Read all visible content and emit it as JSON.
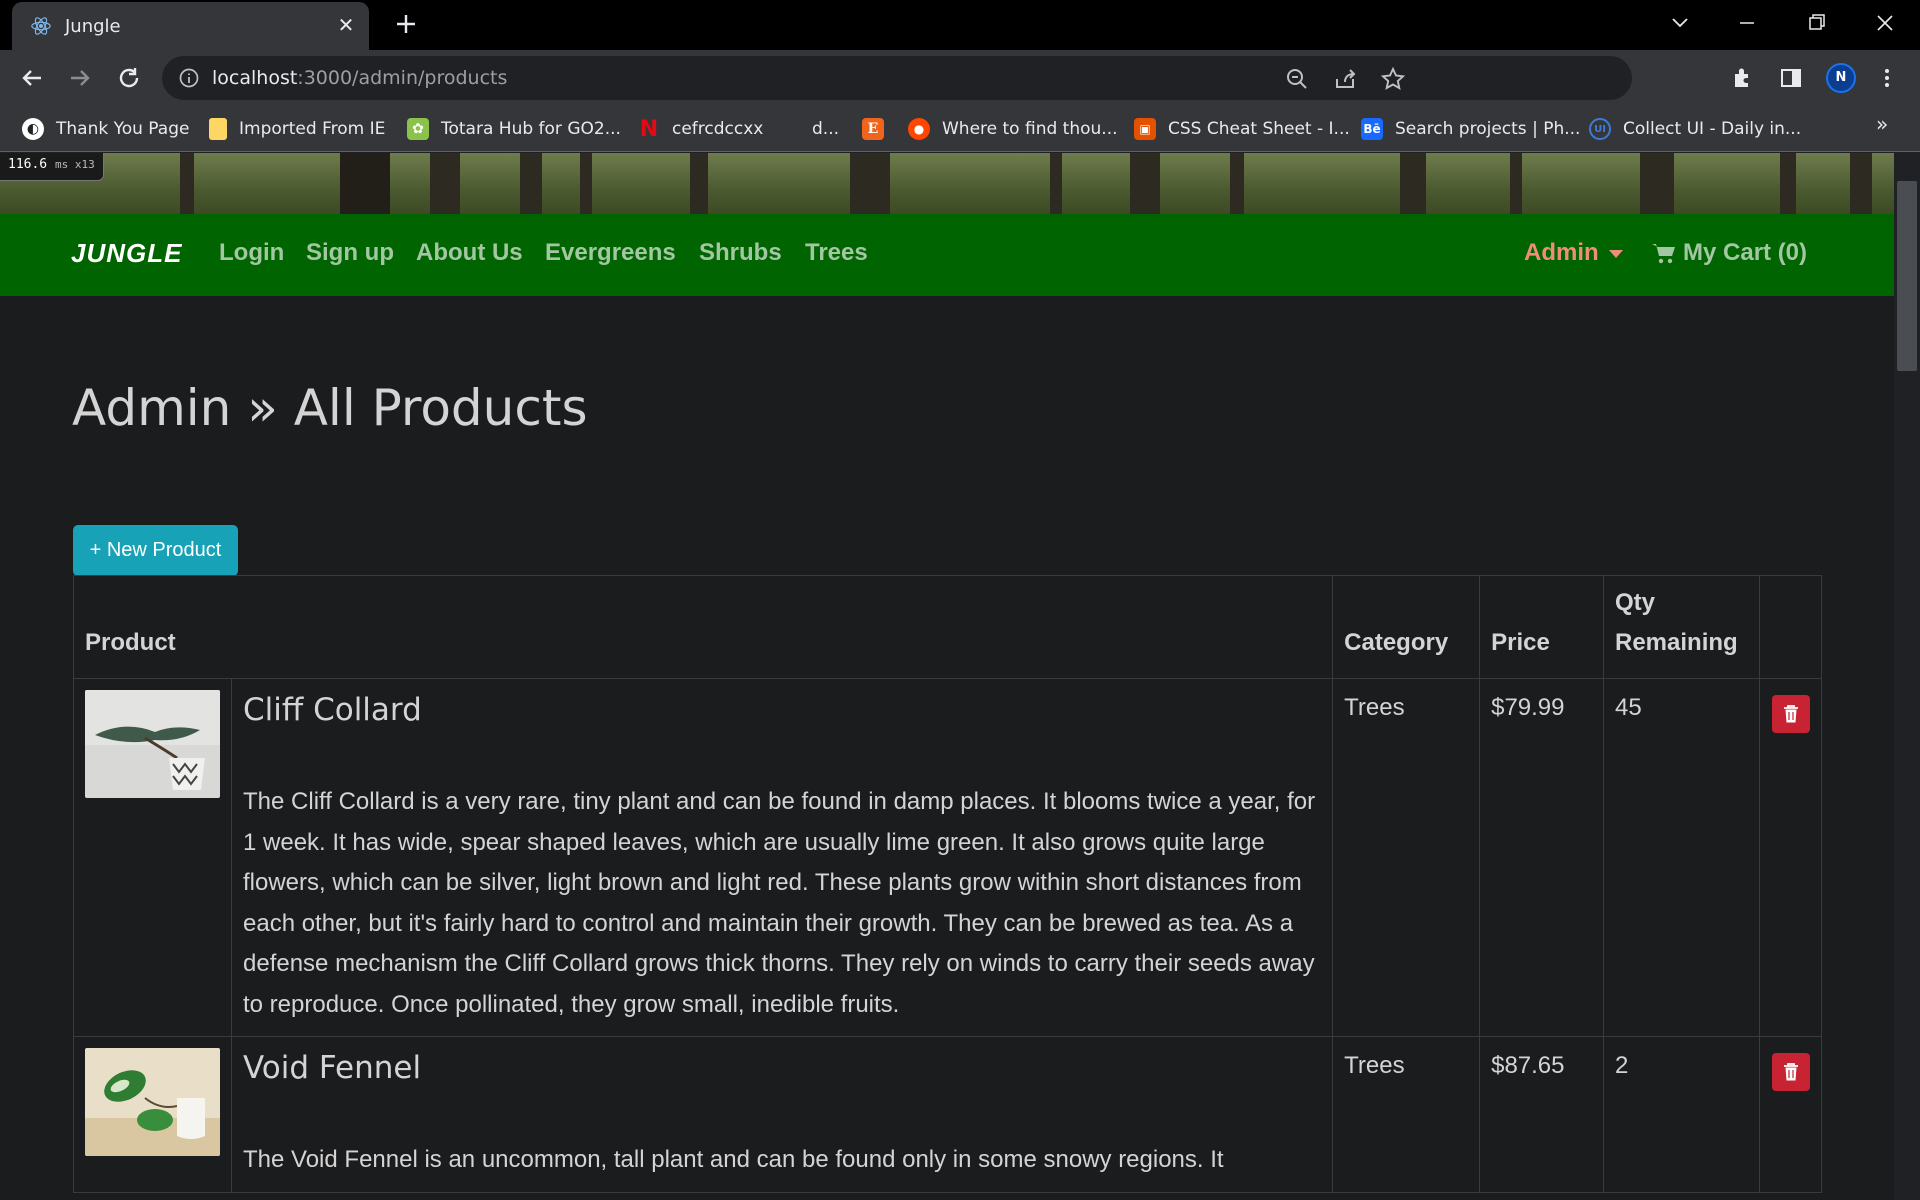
{
  "browser": {
    "tab_title": "Jungle",
    "url_host": "localhost",
    "url_path": ":3000/admin/products",
    "bookmarks": [
      {
        "label": "Thank You Page",
        "icon": "globe-icon"
      },
      {
        "label": "Imported From IE",
        "icon": "folder-icon"
      },
      {
        "label": "Totara Hub for GO2...",
        "icon": "totara-icon"
      },
      {
        "label": "cefrcdccxx",
        "icon": "netflix-icon"
      },
      {
        "label": "d...",
        "icon": "blank-icon"
      },
      {
        "label": "",
        "icon": "etsy-icon"
      },
      {
        "label": "Where to find thou...",
        "icon": "reddit-icon"
      },
      {
        "label": "CSS Cheat Sheet - I...",
        "icon": "gift-icon"
      },
      {
        "label": "Search projects | Ph...",
        "icon": "behance-icon"
      },
      {
        "label": "Collect UI - Daily in...",
        "icon": "collectui-icon"
      }
    ],
    "bookmarks_more": "»",
    "profile_initial": "N"
  },
  "perf": {
    "value": "116.6",
    "unit": "ms x13"
  },
  "nav": {
    "brand": "JUNGLE",
    "links": [
      "Login",
      "Sign up",
      "About Us",
      "Evergreens",
      "Shrubs",
      "Trees"
    ],
    "admin": "Admin",
    "cart": "My Cart (0)"
  },
  "page": {
    "title": "Admin » All Products",
    "new_button": "+ New Product"
  },
  "table": {
    "headers": {
      "product": "Product",
      "category": "Category",
      "price": "Price",
      "qty": "Qty Remaining"
    },
    "rows": [
      {
        "name": "Cliff Collard",
        "description": "The Cliff Collard is a very rare, tiny plant and can be found in damp places. It blooms twice a year, for 1 week. It has wide, spear shaped leaves, which are usually lime green. It also grows quite large flowers, which can be silver, light brown and light red. These plants grow within short distances from each other, but it's fairly hard to control and maintain their growth. They can be brewed as tea. As a defense mechanism the Cliff Collard grows thick thorns. They rely on winds to carry their seeds away to reproduce. Once pollinated, they grow small, inedible fruits.",
        "category": "Trees",
        "price": "$79.99",
        "qty": "45"
      },
      {
        "name": "Void Fennel",
        "description": "The Void Fennel is an uncommon, tall plant and can be found only in some snowy regions. It",
        "category": "Trees",
        "price": "$87.65",
        "qty": "2"
      }
    ]
  },
  "colors": {
    "navbar": "#006400",
    "accent": "#17a2b8",
    "danger": "#c82333",
    "admin_link": "#f08d7a"
  }
}
